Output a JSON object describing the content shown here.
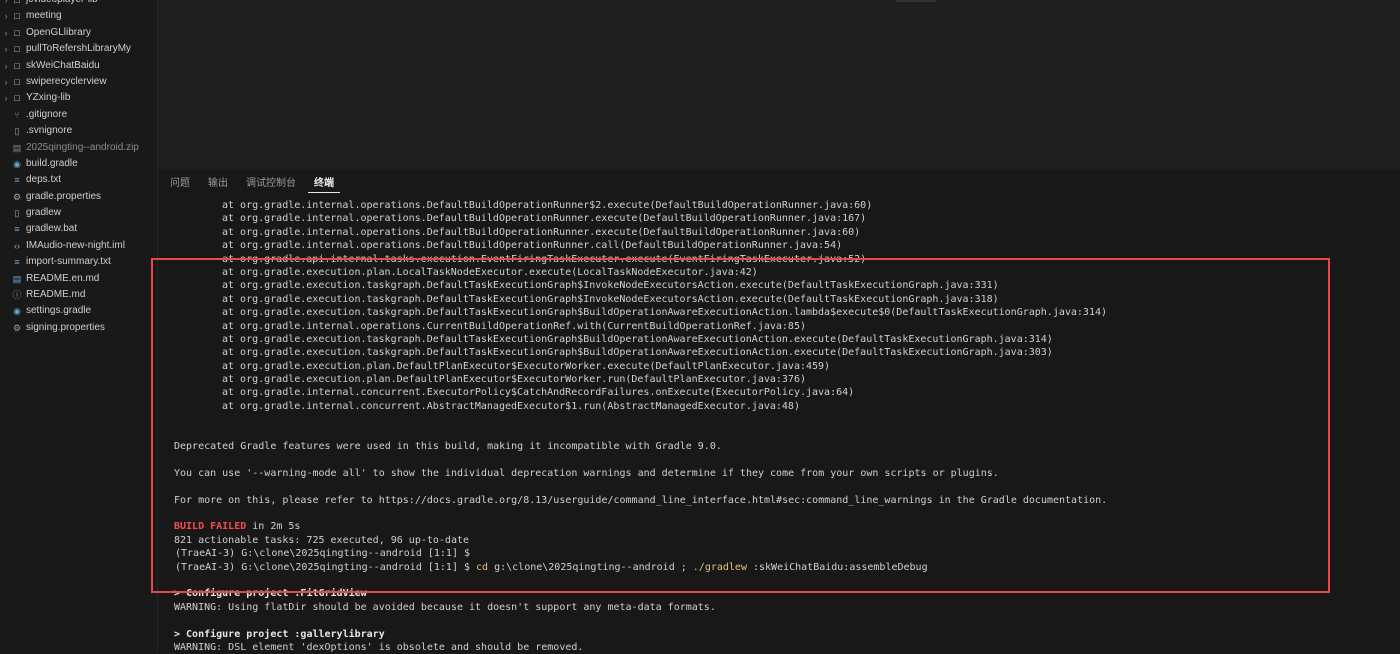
{
  "sidebar": {
    "items": [
      {
        "label": "jcvideoplayer-lib",
        "type": "folder",
        "icon": "folder-icon"
      },
      {
        "label": "meeting",
        "type": "folder",
        "icon": "folder-icon"
      },
      {
        "label": "OpenGLlibrary",
        "type": "folder",
        "icon": "folder-icon"
      },
      {
        "label": "pullToRefershLibraryMy",
        "type": "folder",
        "icon": "folder-icon"
      },
      {
        "label": "skWeiChatBaidu",
        "type": "folder",
        "icon": "folder-icon"
      },
      {
        "label": "swiperecyclerview",
        "type": "folder",
        "icon": "folder-icon"
      },
      {
        "label": "YZxing-lib",
        "type": "folder",
        "icon": "folder-icon"
      },
      {
        "label": ".gitignore",
        "type": "file",
        "icon": "git-icon"
      },
      {
        "label": ".svnignore",
        "type": "file",
        "icon": "file-icon"
      },
      {
        "label": "2025qingting--android.zip",
        "type": "file",
        "icon": "zip-icon"
      },
      {
        "label": "build.gradle",
        "type": "file",
        "icon": "gradle-icon"
      },
      {
        "label": "deps.txt",
        "type": "file",
        "icon": "text-file-icon"
      },
      {
        "label": "gradle.properties",
        "type": "file",
        "icon": "gear-icon"
      },
      {
        "label": "gradlew",
        "type": "file",
        "icon": "file-icon"
      },
      {
        "label": "gradlew.bat",
        "type": "file",
        "icon": "text-file-icon"
      },
      {
        "label": "IMAudio-new-night.iml",
        "type": "file",
        "icon": "xml-icon"
      },
      {
        "label": "import-summary.txt",
        "type": "file",
        "icon": "text-file-icon"
      },
      {
        "label": "README.en.md",
        "type": "file",
        "icon": "markdown-icon"
      },
      {
        "label": "README.md",
        "type": "file",
        "icon": "info-icon"
      },
      {
        "label": "settings.gradle",
        "type": "file",
        "icon": "gradle-icon"
      },
      {
        "label": "signing.properties",
        "type": "file",
        "icon": "gear-icon"
      }
    ]
  },
  "panel": {
    "tabs": [
      {
        "label": "问题",
        "active": false
      },
      {
        "label": "输出",
        "active": false
      },
      {
        "label": "调试控制台",
        "active": false
      },
      {
        "label": "终端",
        "active": true
      }
    ]
  },
  "terminal": {
    "stack_lines": [
      "at org.gradle.internal.operations.DefaultBuildOperationRunner$2.execute(DefaultBuildOperationRunner.java:60)",
      "at org.gradle.internal.operations.DefaultBuildOperationRunner.execute(DefaultBuildOperationRunner.java:167)",
      "at org.gradle.internal.operations.DefaultBuildOperationRunner.execute(DefaultBuildOperationRunner.java:60)",
      "at org.gradle.internal.operations.DefaultBuildOperationRunner.call(DefaultBuildOperationRunner.java:54)",
      "at org.gradle.api.internal.tasks.execution.EventFiringTaskExecuter.execute(EventFiringTaskExecuter.java:52)",
      "at org.gradle.execution.plan.LocalTaskNodeExecutor.execute(LocalTaskNodeExecutor.java:42)",
      "at org.gradle.execution.taskgraph.DefaultTaskExecutionGraph$InvokeNodeExecutorsAction.execute(DefaultTaskExecutionGraph.java:331)",
      "at org.gradle.execution.taskgraph.DefaultTaskExecutionGraph$InvokeNodeExecutorsAction.execute(DefaultTaskExecutionGraph.java:318)",
      "at org.gradle.execution.taskgraph.DefaultTaskExecutionGraph$BuildOperationAwareExecutionAction.lambda$execute$0(DefaultTaskExecutionGraph.java:314)",
      "at org.gradle.internal.operations.CurrentBuildOperationRef.with(CurrentBuildOperationRef.java:85)",
      "at org.gradle.execution.taskgraph.DefaultTaskExecutionGraph$BuildOperationAwareExecutionAction.execute(DefaultTaskExecutionGraph.java:314)",
      "at org.gradle.execution.taskgraph.DefaultTaskExecutionGraph$BuildOperationAwareExecutionAction.execute(DefaultTaskExecutionGraph.java:303)",
      "at org.gradle.execution.plan.DefaultPlanExecutor$ExecutorWorker.execute(DefaultPlanExecutor.java:459)",
      "at org.gradle.execution.plan.DefaultPlanExecutor$ExecutorWorker.run(DefaultPlanExecutor.java:376)",
      "at org.gradle.internal.concurrent.ExecutorPolicy$CatchAndRecordFailures.onExecute(ExecutorPolicy.java:64)",
      "at org.gradle.internal.concurrent.AbstractManagedExecutor$1.run(AbstractManagedExecutor.java:48)"
    ],
    "deprecated_msg": "Deprecated Gradle features were used in this build, making it incompatible with Gradle 9.0.",
    "warning_mode_msg": "You can use '--warning-mode all' to show the individual deprecation warnings and determine if they come from your own scripts or plugins.",
    "docs_msg": "For more on this, please refer to https://docs.gradle.org/8.13/userguide/command_line_interface.html#sec:command_line_warnings in the Gradle documentation.",
    "build_failed": "BUILD FAILED",
    "build_time": " in 2m 5s",
    "tasks_summary": "821 actionable tasks: 725 executed, 96 up-to-date",
    "prompt1": "(TraeAI-3) G:\\clone\\2025qingting--android [1:1] $",
    "prompt2": "(TraeAI-3) G:\\clone\\2025qingting--android [1:1] $ ",
    "cmd_cd": "cd",
    "cmd_path": " g:\\clone\\2025qingting--android ; ",
    "cmd_gradlew": "./gradlew",
    "cmd_task": " :skWeiChatBaidu:assembleDebug",
    "configure1": "> Configure project :FitGridView",
    "warning1": "WARNING: Using flatDir should be avoided because it doesn't support any meta-data formats.",
    "configure2": "> Configure project :gallerylibrary",
    "warning2": "WARNING: DSL element 'dexOptions' is obsolete and should be removed."
  },
  "colors": {
    "highlight_border": "#e84848",
    "build_failed": "#f14c4c",
    "command": "#e5c07b"
  }
}
